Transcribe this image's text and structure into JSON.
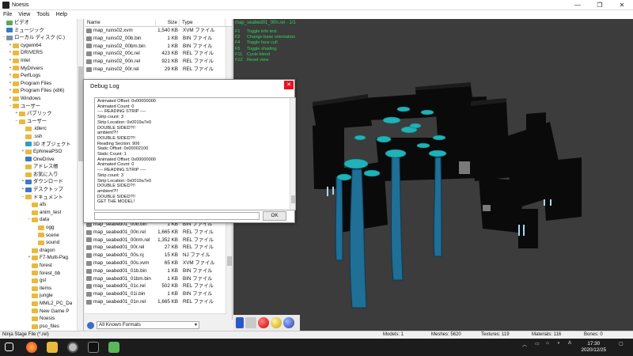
{
  "window": {
    "title": "Noesis"
  },
  "menu": [
    "File",
    "View",
    "Tools",
    "Help"
  ],
  "tree": [
    {
      "label": "ビデオ",
      "indent": 0,
      "exp": "",
      "icon": "pic"
    },
    {
      "label": "ミュージック",
      "indent": 0,
      "exp": "",
      "icon": "blue"
    },
    {
      "label": "ローカル ディスク (C:)",
      "indent": 0,
      "exp": "−",
      "icon": "drive"
    },
    {
      "label": "cygwin64",
      "indent": 1,
      "exp": "+",
      "icon": ""
    },
    {
      "label": "DRIVERS",
      "indent": 1,
      "exp": "+",
      "icon": ""
    },
    {
      "label": "Intel",
      "indent": 1,
      "exp": "+",
      "icon": ""
    },
    {
      "label": "MyDrivers",
      "indent": 1,
      "exp": "+",
      "icon": ""
    },
    {
      "label": "PerfLogs",
      "indent": 1,
      "exp": "+",
      "icon": ""
    },
    {
      "label": "Program Files",
      "indent": 1,
      "exp": "+",
      "icon": ""
    },
    {
      "label": "Program Files (x86)",
      "indent": 1,
      "exp": "+",
      "icon": ""
    },
    {
      "label": "Windows",
      "indent": 1,
      "exp": "+",
      "icon": ""
    },
    {
      "label": "ユーザー",
      "indent": 1,
      "exp": "−",
      "icon": ""
    },
    {
      "label": "パブリック",
      "indent": 2,
      "exp": "+",
      "icon": ""
    },
    {
      "label": "ユーザー",
      "indent": 2,
      "exp": "−",
      "icon": ""
    },
    {
      "label": ".idlerc",
      "indent": 3,
      "exp": "",
      "icon": ""
    },
    {
      "label": ".ssh",
      "indent": 3,
      "exp": "",
      "icon": ""
    },
    {
      "label": "3D オブジェクト",
      "indent": 3,
      "exp": "",
      "icon": "cyan"
    },
    {
      "label": "EphineaPSO",
      "indent": 3,
      "exp": "+",
      "icon": ""
    },
    {
      "label": "OneDrive",
      "indent": 3,
      "exp": "",
      "icon": "blue"
    },
    {
      "label": "アドレス帳",
      "indent": 3,
      "exp": "",
      "icon": ""
    },
    {
      "label": "お気に入り",
      "indent": 3,
      "exp": "",
      "icon": ""
    },
    {
      "label": "ダウンロード",
      "indent": 3,
      "exp": "+",
      "icon": "blue"
    },
    {
      "label": "デスクトップ",
      "indent": 3,
      "exp": "+",
      "icon": "blue"
    },
    {
      "label": "ドキュメント",
      "indent": 3,
      "exp": "−",
      "icon": ""
    },
    {
      "label": "afs",
      "indent": 4,
      "exp": "",
      "icon": ""
    },
    {
      "label": "anim_test",
      "indent": 4,
      "exp": "",
      "icon": ""
    },
    {
      "label": "data",
      "indent": 4,
      "exp": "−",
      "icon": ""
    },
    {
      "label": "ogg",
      "indent": 5,
      "exp": "",
      "icon": ""
    },
    {
      "label": "scene",
      "indent": 5,
      "exp": "",
      "icon": ""
    },
    {
      "label": "sound",
      "indent": 5,
      "exp": "",
      "icon": ""
    },
    {
      "label": "dragon",
      "indent": 4,
      "exp": "",
      "icon": ""
    },
    {
      "label": "F7-Multi-Pag",
      "indent": 4,
      "exp": "+",
      "icon": ""
    },
    {
      "label": "forest",
      "indent": 4,
      "exp": "",
      "icon": ""
    },
    {
      "label": "forest_bb",
      "indent": 4,
      "exp": "",
      "icon": ""
    },
    {
      "label": "gsl",
      "indent": 4,
      "exp": "",
      "icon": ""
    },
    {
      "label": "items",
      "indent": 4,
      "exp": "",
      "icon": ""
    },
    {
      "label": "jungle",
      "indent": 4,
      "exp": "",
      "icon": ""
    },
    {
      "label": "MML2_PC_Da",
      "indent": 4,
      "exp": "",
      "icon": ""
    },
    {
      "label": "New Game P",
      "indent": 4,
      "exp": "",
      "icon": ""
    },
    {
      "label": "Noesis",
      "indent": 4,
      "exp": "",
      "icon": ""
    },
    {
      "label": "pso_files",
      "indent": 4,
      "exp": "",
      "icon": ""
    },
    {
      "label": "PuyoTools",
      "indent": 4,
      "exp": "",
      "icon": ""
    }
  ],
  "files": {
    "headers": {
      "name": "Name",
      "size": "Size",
      "type": "Type"
    },
    "rows": [
      {
        "name": "map_ruins02.xvm",
        "size": "1,540 KB",
        "type": "XVM ファイル"
      },
      {
        "name": "map_ruins02_00b.bin",
        "size": "1 KB",
        "type": "BIN ファイル"
      },
      {
        "name": "map_ruins02_00bm.bin",
        "size": "1 KB",
        "type": "BIN ファイル"
      },
      {
        "name": "map_ruins02_00c.rel",
        "size": "423 KB",
        "type": "REL ファイル"
      },
      {
        "name": "map_ruins02_00n.rel",
        "size": "921 KB",
        "type": "REL ファイル"
      },
      {
        "name": "map_ruins02_00r.rel",
        "size": "29 KB",
        "type": "REL ファイル"
      },
      {
        "name": "",
        "size": "",
        "type": ""
      },
      {
        "name": "",
        "size": "",
        "type": ""
      },
      {
        "name": "",
        "size": "",
        "type": ""
      },
      {
        "name": "",
        "size": "",
        "type": ""
      },
      {
        "name": "",
        "size": "",
        "type": ""
      },
      {
        "name": "",
        "size": "",
        "type": ""
      },
      {
        "name": "",
        "size": "",
        "type": ""
      },
      {
        "name": "",
        "size": "",
        "type": ""
      },
      {
        "name": "",
        "size": "",
        "type": ""
      },
      {
        "name": "",
        "size": "",
        "type": ""
      },
      {
        "name": "",
        "size": "",
        "type": ""
      },
      {
        "name": "",
        "size": "",
        "type": ""
      },
      {
        "name": "",
        "size": "",
        "type": ""
      },
      {
        "name": "",
        "size": "",
        "type": ""
      },
      {
        "name": "",
        "size": "",
        "type": ""
      },
      {
        "name": "",
        "size": "",
        "type": ""
      },
      {
        "name": "",
        "size": "",
        "type": ""
      },
      {
        "name": "",
        "size": "",
        "type": ""
      },
      {
        "name": "",
        "size": "",
        "type": ""
      },
      {
        "name": "map_seabed01_00b.bin",
        "size": "1 KB",
        "type": "BIN ファイル"
      },
      {
        "name": "map_seabed01_00n.rel",
        "size": "1,665 KB",
        "type": "REL ファイル"
      },
      {
        "name": "map_seabed01_00nm.rel",
        "size": "1,352 KB",
        "type": "REL ファイル"
      },
      {
        "name": "map_seabed01_00r.rel",
        "size": "27 KB",
        "type": "REL ファイル"
      },
      {
        "name": "map_seabed01_00s.nj",
        "size": "15 KB",
        "type": "NJ ファイル"
      },
      {
        "name": "map_seabed01_00s.xvm",
        "size": "65 KB",
        "type": "XVM ファイル"
      },
      {
        "name": "map_seabed01_01b.bin",
        "size": "1 KB",
        "type": "BIN ファイル"
      },
      {
        "name": "map_seabed01_01bm.bin",
        "size": "1 KB",
        "type": "BIN ファイル"
      },
      {
        "name": "map_seabed01_01c.rel",
        "size": "502 KB",
        "type": "REL ファイル"
      },
      {
        "name": "map_seabed01_01i.bin",
        "size": "1 KB",
        "type": "BIN ファイル"
      },
      {
        "name": "map_seabed01_01n.rel",
        "size": "1,665 KB",
        "type": "REL ファイル"
      }
    ]
  },
  "format": {
    "label": "All Known Formats"
  },
  "viewport": {
    "title": "map_seabed01_00n.rel - 1/1",
    "keys": [
      {
        "k": "F1",
        "v": "Toggle info text"
      },
      {
        "k": "F2",
        "v": "Change base orientation"
      },
      {
        "k": "F4",
        "v": "Toggle face cull"
      },
      {
        "k": "F5",
        "v": "Toggle shading"
      },
      {
        "k": "F11",
        "v": "Cycle blend"
      },
      {
        "k": "F12",
        "v": "Reset view"
      }
    ]
  },
  "dialog": {
    "title": "Debug Log",
    "close": "✕",
    "ok": "OK",
    "lines": [
      "Animated Offset: 0x00000000",
      "Animated Count: 0",
      "---- READING STRIP ----",
      "Strip count: 3",
      "Strip Location: 0x0019a7e0",
      "DOUBLE SIDED?!!",
      "ambient?!!",
      "DOUBLE SIDED?!!",
      "Reading Section: 906",
      "Static Offset: 0x00002100",
      "Static Count: 1",
      "Animated Offset: 0x00000000",
      "Animated Count: 0",
      "---- READING STRIP ----",
      "Strip count: 3",
      "Strip Location: 0x0019a7e0",
      "DOUBLE SIDED?!!",
      "ambient?!!",
      "DOUBLE SIDED?!!",
      "GET THE MODEL!"
    ]
  },
  "status": {
    "file": "Ninja Stage File (*.rel)",
    "models": "Models: 1",
    "meshes": "Meshes: 5620",
    "textures": "Textures: 119",
    "materials": "Materials: 116",
    "bones": "Bones: 0"
  },
  "taskbar": {
    "time": "17:30",
    "date": "2020/12/25",
    "lang": "A"
  },
  "colors": {
    "viewport_bg": "#3c3c3c",
    "overlay_text": "#2fd65a",
    "seaweed": "#1fb2b8",
    "close_red": "#e81123"
  }
}
